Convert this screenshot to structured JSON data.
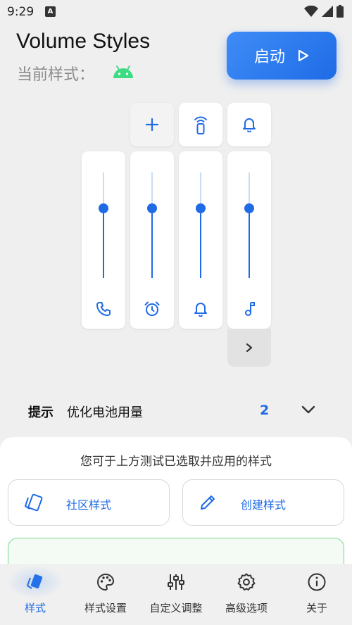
{
  "status_bar": {
    "time": "9:29",
    "notification_badge": "A"
  },
  "header": {
    "title": "Volume Styles",
    "current_style_label": "当前样式：",
    "current_style_icon": "android-icon"
  },
  "start_button": {
    "label": "启动",
    "icon": "play-icon"
  },
  "volume_panel": {
    "top_buttons": [
      "plus-icon",
      "cast-remote-icon",
      "bell-icon"
    ],
    "sliders": [
      {
        "name": "call",
        "icon": "phone-icon",
        "level": 0.66
      },
      {
        "name": "alarm",
        "icon": "alarm-icon",
        "level": 0.66
      },
      {
        "name": "notification",
        "icon": "bell-icon",
        "level": 0.66
      },
      {
        "name": "media",
        "icon": "music-note-icon",
        "level": 0.66
      }
    ],
    "expand_icon": "chevron-right-icon"
  },
  "hint": {
    "label": "提示",
    "text": "优化电池用量",
    "count": "2"
  },
  "sheet": {
    "tip": "您可于上方测试已选取并应用的样式",
    "community_button": "社区样式",
    "create_button": "创建样式"
  },
  "bottom_nav": [
    {
      "label": "样式",
      "icon": "style-cards-icon",
      "active": true
    },
    {
      "label": "样式设置",
      "icon": "palette-icon",
      "active": false
    },
    {
      "label": "自定义调整",
      "icon": "sliders-icon",
      "active": false
    },
    {
      "label": "高级选项",
      "icon": "gear-icon",
      "active": false
    },
    {
      "label": "关于",
      "icon": "info-icon",
      "active": false
    }
  ],
  "colors": {
    "accent": "#1f6be6",
    "android_green": "#3ddc84",
    "sheet_card_border": "#79d98b"
  }
}
